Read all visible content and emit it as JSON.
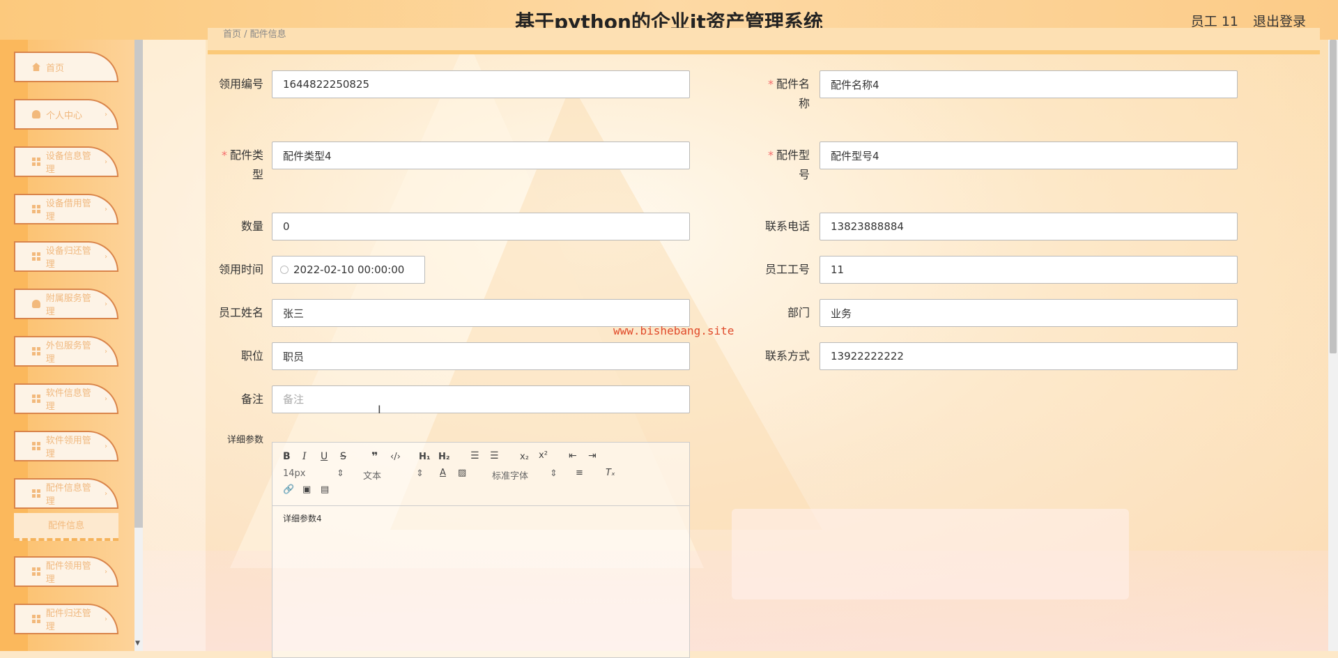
{
  "header": {
    "title": "基于python的企业it资产管理系统",
    "user": "员工 11",
    "logout": "退出登录"
  },
  "sidebar": {
    "items": [
      {
        "label": "首页",
        "icon": "home-icon"
      },
      {
        "label": "个人中心",
        "icon": "user-icon"
      },
      {
        "label": "设备信息管理",
        "icon": "grid-icon"
      },
      {
        "label": "设备借用管理",
        "icon": "grid-icon"
      },
      {
        "label": "设备归还管理",
        "icon": "grid-icon"
      },
      {
        "label": "附属服务管理",
        "icon": "user-icon"
      },
      {
        "label": "外包服务管理",
        "icon": "grid-icon"
      },
      {
        "label": "软件信息管理",
        "icon": "grid-icon"
      },
      {
        "label": "软件领用管理",
        "icon": "grid-icon"
      },
      {
        "label": "配件信息管理",
        "icon": "grid-icon"
      },
      {
        "label": "配件领用管理",
        "icon": "grid-icon"
      },
      {
        "label": "配件归还管理",
        "icon": "grid-icon"
      }
    ],
    "active_sub": "配件信息"
  },
  "breadcrumb": "首页 / 配件信息",
  "form": {
    "receive_no_label": "领用编号",
    "receive_no": "1644822250825",
    "part_name_label_1": "配件名",
    "part_name_label_2": "称",
    "part_name": "配件名称4",
    "part_type_label_1": "配件类",
    "part_type_label_2": "型",
    "part_type": "配件类型4",
    "part_model_label_1": "配件型",
    "part_model_label_2": "号",
    "part_model": "配件型号4",
    "quantity_label": "数量",
    "quantity": "0",
    "phone_label": "联系电话",
    "phone": "13823888884",
    "time_label": "领用时间",
    "time": "2022-02-10 00:00:00",
    "emp_no_label": "员工工号",
    "emp_no": "11",
    "emp_name_label": "员工姓名",
    "emp_name": "张三",
    "dept_label": "部门",
    "dept": "业务",
    "position_label": "职位",
    "position": "职员",
    "contact_label": "联系方式",
    "contact": "13922222222",
    "remark_label": "备注",
    "remark_placeholder": "备注",
    "detail_label": "详细参数"
  },
  "editor": {
    "font_size": "14px",
    "paragraph": "文本",
    "font_family": "标准字体",
    "content": "详细参数4"
  },
  "watermark": "www.bishebang.site"
}
